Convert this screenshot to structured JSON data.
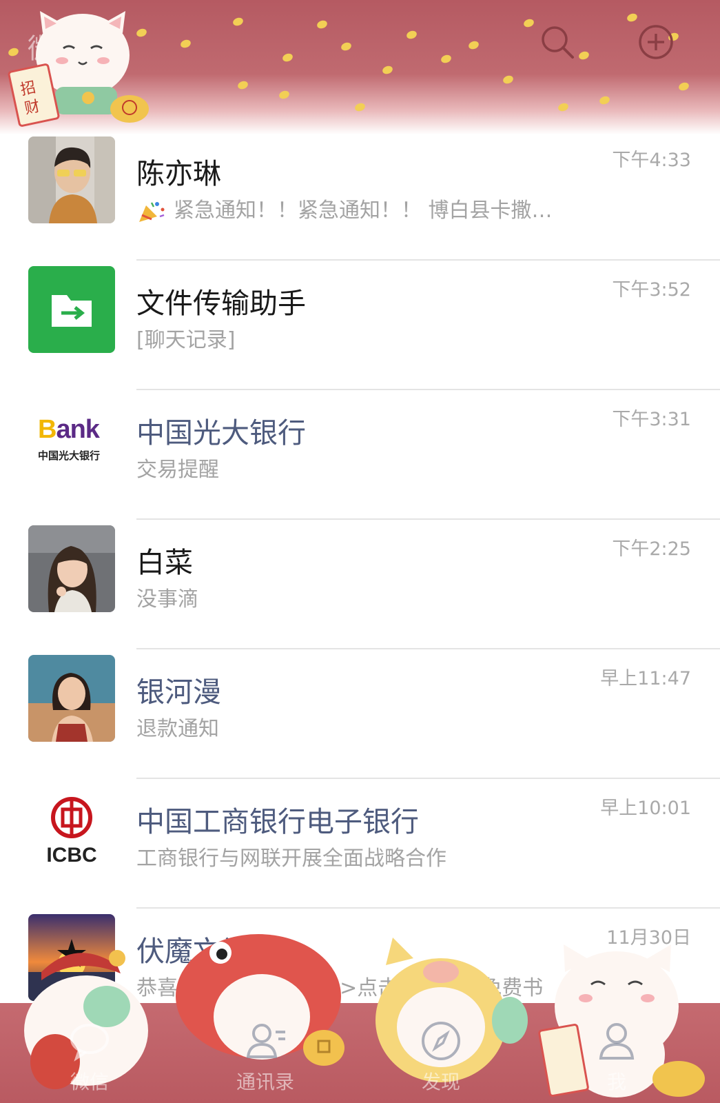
{
  "header": {
    "title": "微信",
    "search_icon": "search-icon",
    "add_icon": "plus-circle-icon",
    "sticker_text": "招财"
  },
  "chats": [
    {
      "name": "陈亦琳",
      "preview": "紧急通知！！紧急通知！！ 博白县卡撒…",
      "time": "下午4:33",
      "official": false,
      "avatar": "photo-woman-glasses"
    },
    {
      "name": "文件传输助手",
      "preview": "[聊天记录]",
      "time": "下午3:52",
      "official": false,
      "avatar": "file-transfer-icon"
    },
    {
      "name": "中国光大银行",
      "preview": "交易提醒",
      "time": "下午3:31",
      "official": true,
      "avatar": "bank-logo",
      "logo_text": "Bank",
      "logo_sub": "中国光大银行"
    },
    {
      "name": "白菜",
      "preview": "没事滴",
      "time": "下午2:25",
      "official": false,
      "avatar": "photo-girl-curly"
    },
    {
      "name": "银河漫",
      "preview": "退款通知",
      "time": "早上11:47",
      "official": true,
      "avatar": "photo-woman-red"
    },
    {
      "name": "中国工商银行电子银行",
      "preview": "工商银行与网联开展全面战略合作",
      "time": "早上10:01",
      "official": true,
      "avatar": "icbc-logo",
      "logo_text": "ICBC"
    },
    {
      "name": "伏魔文学",
      "preview": "恭喜您成为<幸运书友>点击有机会得免费书",
      "time": "11月30日",
      "official": true,
      "avatar": "sunset-star-logo"
    }
  ],
  "tabs": [
    {
      "label": "微信",
      "icon": "chat-bubble-icon"
    },
    {
      "label": "通讯录",
      "icon": "contacts-icon"
    },
    {
      "label": "发现",
      "icon": "compass-icon"
    },
    {
      "label": "我",
      "icon": "person-icon"
    }
  ],
  "colors": {
    "header_bg": "#b55a62",
    "tabbar_bg": "#c56a70",
    "coin": "#f2cf55",
    "official_name": "#4e5b7e",
    "file_transfer_green": "#2aae4b",
    "icbc_red": "#c7161e"
  }
}
